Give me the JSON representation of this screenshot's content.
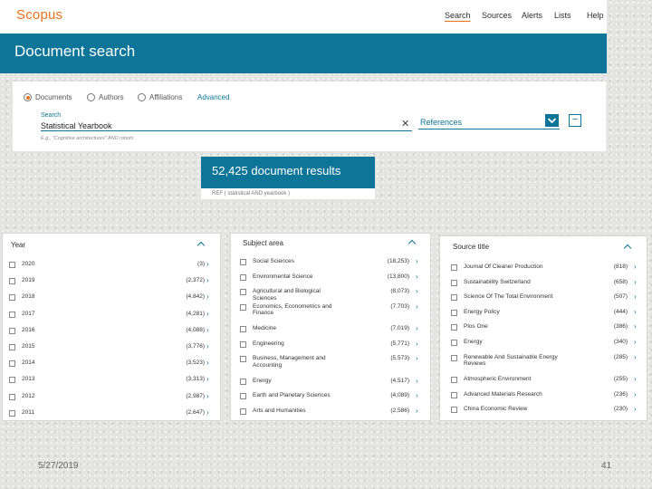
{
  "app": {
    "logo": "Scopus"
  },
  "nav": [
    "Search",
    "Sources",
    "Alerts",
    "Lists",
    "Help"
  ],
  "banner": {
    "title": "Document search"
  },
  "search_tabs": {
    "documents": "Documents",
    "authors": "Authors",
    "affiliations": "Affiliations",
    "advanced": "Advanced"
  },
  "search": {
    "label": "Search",
    "value": "Statistical Yearbook",
    "hint": "E.g., \"Cognitive architectures\" AND robots",
    "field": "References"
  },
  "results": {
    "count_text": "52,425 document results",
    "query": "REF ( statistical AND yearbook )"
  },
  "facets": {
    "year": {
      "title": "Year",
      "items": [
        {
          "label": "2020",
          "count": "(3)"
        },
        {
          "label": "2019",
          "count": "(2,372)"
        },
        {
          "label": "2018",
          "count": "(4,842)"
        },
        {
          "label": "2017",
          "count": "(4,281)"
        },
        {
          "label": "2016",
          "count": "(4,088)"
        },
        {
          "label": "2015",
          "count": "(3,776)"
        },
        {
          "label": "2014",
          "count": "(3,523)"
        },
        {
          "label": "2013",
          "count": "(3,313)"
        },
        {
          "label": "2012",
          "count": "(2,987)"
        },
        {
          "label": "2011",
          "count": "(2,647)"
        }
      ]
    },
    "subject": {
      "title": "Subject area",
      "items": [
        {
          "label": "Social Sciences",
          "count": "(18,253)"
        },
        {
          "label": "Environmental Science",
          "count": "(13,800)"
        },
        {
          "label": "Agricultural and Biological Sciences",
          "count": "(8,073)"
        },
        {
          "label": "Economics, Econometrics and Finance",
          "count": "(7,703)"
        },
        {
          "label": "Medicine",
          "count": "(7,019)"
        },
        {
          "label": "Engineering",
          "count": "(5,771)"
        },
        {
          "label": "Business, Management and Accounting",
          "count": "(5,573)"
        },
        {
          "label": "Energy",
          "count": "(4,517)"
        },
        {
          "label": "Earth and Planetary Sciences",
          "count": "(4,089)"
        },
        {
          "label": "Arts and Humanities",
          "count": "(2,586)"
        }
      ]
    },
    "source": {
      "title": "Source title",
      "items": [
        {
          "label": "Journal Of Cleaner Production",
          "count": "(818)"
        },
        {
          "label": "Sustainability Switzerland",
          "count": "(658)"
        },
        {
          "label": "Science Of The Total Environment",
          "count": "(507)"
        },
        {
          "label": "Energy Policy",
          "count": "(444)"
        },
        {
          "label": "Plos One",
          "count": "(386)"
        },
        {
          "label": "Energy",
          "count": "(340)"
        },
        {
          "label": "Renewable And Sustainable Energy Reviews",
          "count": "(285)"
        },
        {
          "label": "Atmospheric Environment",
          "count": "(255)"
        },
        {
          "label": "Advanced Materials Research",
          "count": "(236)"
        },
        {
          "label": "China Economic Review",
          "count": "(230)"
        }
      ]
    }
  },
  "footer": {
    "date": "5/27/2019",
    "page": "41"
  },
  "colors": {
    "brand": "#0d7597",
    "logo": "#e9711c"
  }
}
